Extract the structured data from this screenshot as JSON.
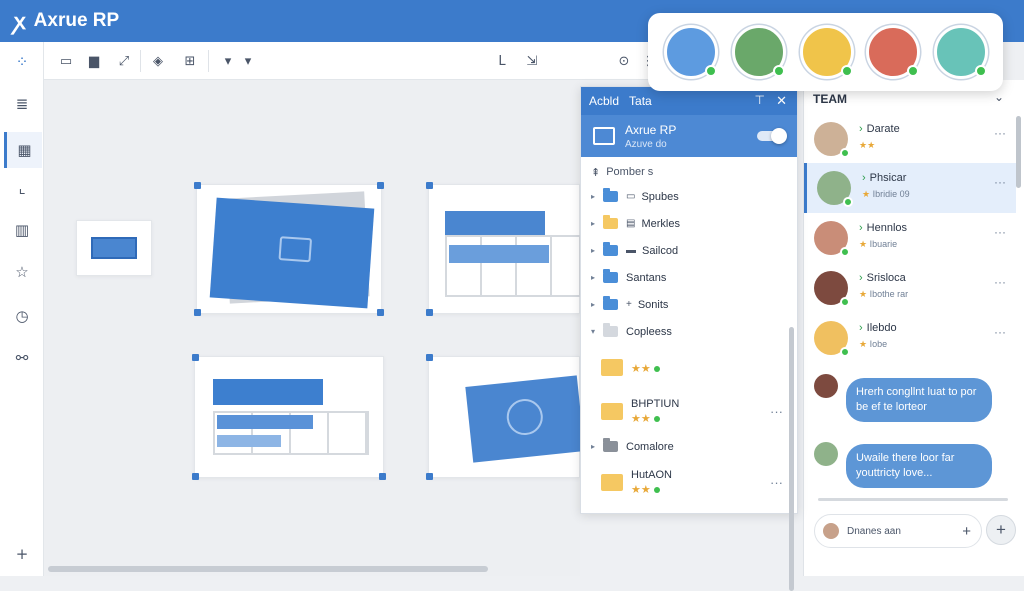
{
  "app": {
    "logo_glyph": "ꭗ",
    "title": "Axrue RP"
  },
  "title_mini": [
    "...",
    "--"
  ],
  "left_toolbar": {
    "items": [
      "grid-dots-icon",
      "filter-icon",
      "layout-icon",
      "chart-icon",
      "table-icon",
      "star-icon",
      "history-icon",
      "connect-icon",
      "add-icon"
    ]
  },
  "toolbar": {
    "items": [
      "frame-icon",
      "folder-icon",
      "link-icon",
      "shield-icon",
      "grid-icon",
      "arrow-down-icon",
      "chevron-down-icon",
      "text-icon",
      "export-icon",
      "pin-icon",
      "align-icon"
    ]
  },
  "avatars": {
    "colors": [
      "#5d9be0",
      "#6aa86a",
      "#f0c44a",
      "#d96b5a",
      "#68c3b8"
    ]
  },
  "panel": {
    "tab_1": "Acbld",
    "tab_2": "Tata",
    "pin": "⊤",
    "close": "✕",
    "selected": {
      "name": "Axrue RP",
      "sub": "Azuve do"
    },
    "section": "Pomber s",
    "section_icon": "⇞",
    "items": [
      {
        "label": "Spubes",
        "folder": "blue",
        "sub_icon": "▭"
      },
      {
        "label": "Merkles",
        "folder": "yellow",
        "sub_icon": "▤"
      },
      {
        "label": "Sailcod",
        "folder": "blue",
        "sub_icon": "▬"
      },
      {
        "label": "Santans",
        "folder": "blue",
        "sub_icon": ""
      },
      {
        "label": "Sonits",
        "folder": "blue",
        "sub_icon": "+"
      },
      {
        "label": "Copleess",
        "folder": "light",
        "sub_icon": ""
      }
    ],
    "big_1": {
      "label": "",
      "stars": "★★"
    },
    "big_2": {
      "label": "BHPTIUN",
      "stars": "★★"
    },
    "comalore": "Comalore",
    "big_3": {
      "label": "HutAON",
      "stars": "★★"
    },
    "more": "···"
  },
  "team": {
    "title": "TEAM",
    "caret": "⌄",
    "members": [
      {
        "name": "Darate",
        "sub": "★★",
        "sub_extra": "",
        "avatar": "#cdb197"
      },
      {
        "name": "Phsicar",
        "sub": "★",
        "sub_extra": "Ibridie 09",
        "avatar": "#8fb28a"
      },
      {
        "name": "Hennlos",
        "sub": "★",
        "sub_extra": "Ibuarie",
        "avatar": "#c98d78"
      },
      {
        "name": "Srisloca",
        "sub": "★",
        "sub_extra": "Ibothe rar",
        "avatar": "#7d4a3f"
      },
      {
        "name": "Ilebdo",
        "sub": "★",
        "sub_extra": "Iobe",
        "avatar": "#f0c060"
      }
    ],
    "more": "···",
    "bubbles": [
      {
        "text": "Hrerh congllnt luat to por be ef te lorteor"
      },
      {
        "text": "Uwaile there loor far youttricty love..."
      }
    ],
    "compose_placeholder": "Dnanes aan",
    "compose_plus": "+",
    "add": "+"
  }
}
